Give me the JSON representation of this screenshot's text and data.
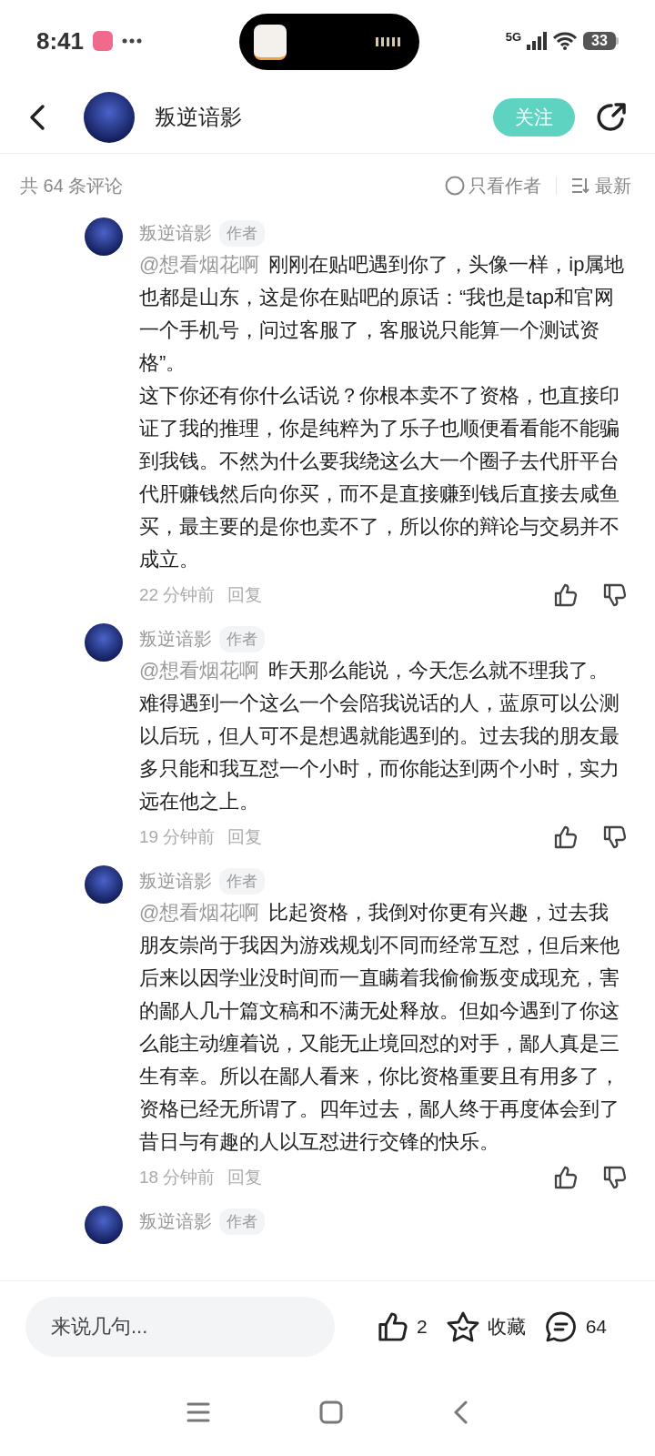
{
  "status_bar": {
    "time": "8:41",
    "network": "5G",
    "battery": "33"
  },
  "header": {
    "title": "叛逆谙影",
    "follow_button": "关注"
  },
  "filter_bar": {
    "count": "共 64 条评论",
    "author_only": {
      "label": "只看作者",
      "checked": false
    },
    "sort": "最新"
  },
  "comments": [
    {
      "author": "叛逆谙影",
      "badge": "作者",
      "mention": "@想看烟花啊",
      "text": "刚刚在贴吧遇到你了，头像一样，ip属地也都是山东，这是你在贴吧的原话：“我也是tap和官网一个手机号，问过客服了，客服说只能算一个测试资格”。",
      "text_2": "这下你还有你什么话说？你根本卖不了资格，也直接印证了我的推理，你是纯粹为了乐子也顺便看看能不能骗到我钱。不然为什么要我绕这么大一个圈子去代肝平台代肝赚钱然后向你买，而不是直接赚到钱后直接去咸鱼买，最主要的是你也卖不了，所以你的辩论与交易并不成立。",
      "time": "22 分钟前",
      "reply": "回复"
    },
    {
      "author": "叛逆谙影",
      "badge": "作者",
      "mention": "@想看烟花啊",
      "text": "昨天那么能说，今天怎么就不理我了。难得遇到一个这么一个会陪我说话的人，蓝原可以公测以后玩，但人可不是想遇就能遇到的。过去我的朋友最多只能和我互怼一个小时，而你能达到两个小时，实力远在他之上。",
      "time": "19 分钟前",
      "reply": "回复"
    },
    {
      "author": "叛逆谙影",
      "badge": "作者",
      "mention": "@想看烟花啊",
      "text": "比起资格，我倒对你更有兴趣，过去我朋友崇尚于我因为游戏规划不同而经常互怼，但后来他后来以因学业没时间而一直瞒着我偷偷叛变成现充，害的鄙人几十篇文稿和不满无处释放。但如今遇到了你这么能主动缠着说，又能无止境回怼的对手，鄙人真是三生有幸。所以在鄙人看来，你比资格重要且有用多了，资格已经无所谓了。四年过去，鄙人终于再度体会到了昔日与有趣的人以互怼进行交锋的快乐。",
      "time": "18 分钟前",
      "reply": "回复"
    },
    {
      "author": "叛逆谙影",
      "badge": "作者"
    }
  ],
  "bottom_bar": {
    "placeholder": "来说几句...",
    "likes": "2",
    "favorite": "收藏",
    "comments": "64"
  }
}
